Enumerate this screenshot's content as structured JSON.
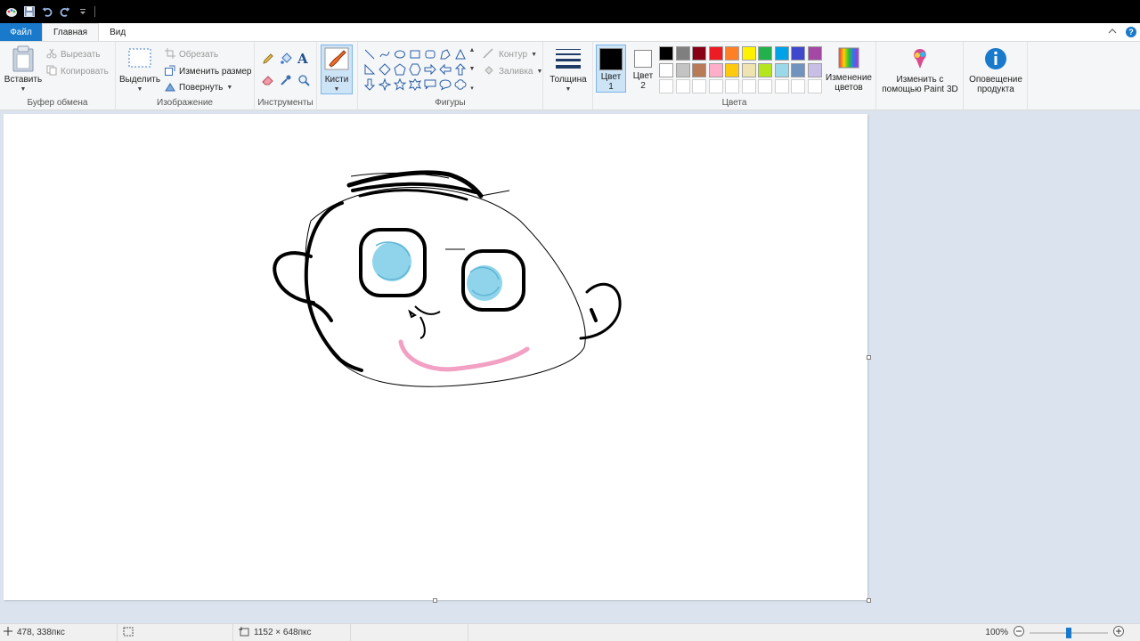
{
  "menu": {
    "file": "Файл",
    "home": "Главная",
    "view": "Вид"
  },
  "clipboard": {
    "paste": "Вставить",
    "cut": "Вырезать",
    "copy": "Копировать",
    "label": "Буфер обмена"
  },
  "image": {
    "select": "Выделить",
    "crop": "Обрезать",
    "resize": "Изменить размер",
    "rotate": "Повернуть",
    "label": "Изображение"
  },
  "tools": {
    "label": "Инструменты"
  },
  "brushes": {
    "label": "Кисти"
  },
  "shapes": {
    "outline": "Контур",
    "fill": "Заливка",
    "label": "Фигуры"
  },
  "size": {
    "label": "Толщина"
  },
  "colors": {
    "color1_line1": "Цвет",
    "color1_line2": "1",
    "color2_line1": "Цвет",
    "color2_line2": "2",
    "edit_line1": "Изменение",
    "edit_line2": "цветов",
    "label": "Цвета",
    "color1_value": "#000000",
    "color2_value": "#ffffff",
    "palette_row1": [
      "#000000",
      "#7f7f7f",
      "#880015",
      "#ed1c24",
      "#ff7f27",
      "#fff200",
      "#22b14c",
      "#00a2e8",
      "#3f48cc",
      "#a349a4"
    ],
    "palette_row2": [
      "#ffffff",
      "#c3c3c3",
      "#b97a57",
      "#ffaec9",
      "#ffc90e",
      "#efe4b0",
      "#b5e61d",
      "#99d9ea",
      "#7092be",
      "#c8bfe7"
    ],
    "palette_row3": [
      "#ffffff",
      "#ffffff",
      "#ffffff",
      "#ffffff",
      "#ffffff",
      "#ffffff",
      "#ffffff",
      "#ffffff",
      "#ffffff",
      "#ffffff"
    ]
  },
  "paint3d": {
    "line1": "Изменить с",
    "line2": "помощью Paint 3D"
  },
  "notice": {
    "line1": "Оповещение",
    "line2": "продукта"
  },
  "status": {
    "cursor": "478, 338пкс",
    "selection": "",
    "image_size": "1152 × 648пкс",
    "file_size": "",
    "zoom": "100%",
    "zoom_level_fraction": 0.5
  },
  "icons": {
    "paste": "clipboard-icon",
    "cut": "scissors-icon",
    "copy": "copy-icon",
    "select": "selection-rect-icon",
    "crop": "crop-icon",
    "resize": "resize-icon",
    "rotate": "rotate-icon",
    "pencil": "pencil-icon",
    "fill": "bucket-icon",
    "text": "text-icon",
    "eraser": "eraser-icon",
    "picker": "color-picker-icon",
    "magnifier": "magnifier-icon",
    "brush": "brush-icon",
    "size": "line-size-icon",
    "edit_colors": "rainbow-icon",
    "paint3d": "paint3d-icon",
    "notice": "info-icon"
  }
}
